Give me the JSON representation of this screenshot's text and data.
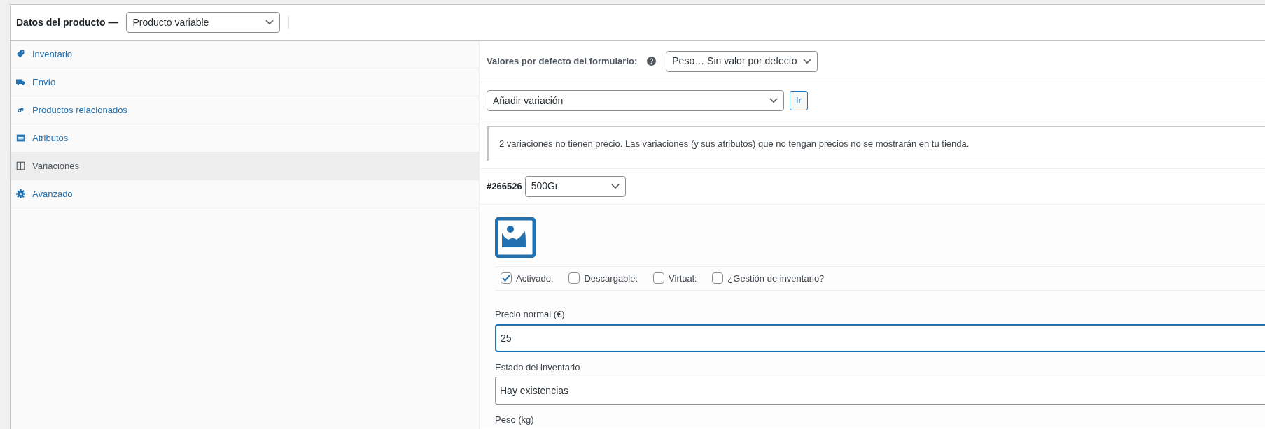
{
  "header": {
    "title": "Datos del producto —",
    "product_type": "Producto variable"
  },
  "sidebar": {
    "items": [
      {
        "label": "Inventario",
        "kind": "tag",
        "selected": false
      },
      {
        "label": "Envío",
        "kind": "truck",
        "selected": false
      },
      {
        "label": "Productos relacionados",
        "kind": "link",
        "selected": false
      },
      {
        "label": "Atributos",
        "kind": "list",
        "selected": false
      },
      {
        "label": "Variaciones",
        "kind": "grid",
        "selected": true
      },
      {
        "label": "Avanzado",
        "kind": "gear",
        "selected": false
      }
    ]
  },
  "variations": {
    "defaults": {
      "label": "Valores por defecto del formulario:",
      "value": "Peso… Sin valor por defecto"
    },
    "add_select": {
      "value": "Añadir variación"
    },
    "go_button": "Ir",
    "notice": "2 variaciones no tienen precio. Las variaciones (y sus atributos) que no tengan precios no se mostrarán en tu tienda.",
    "variation": {
      "id": "#266526",
      "attribute": "500Gr",
      "options": [
        {
          "label": "Activado:",
          "checked": true
        },
        {
          "label": "Descargable:",
          "checked": false
        },
        {
          "label": "Virtual:",
          "checked": false
        },
        {
          "label": "¿Gestión de inventario?",
          "checked": false
        }
      ],
      "fields": [
        {
          "label": "Precio normal (€)",
          "value": "25",
          "focused": true
        },
        {
          "label": "Estado del inventario",
          "value": "Hay existencias",
          "focused": false
        },
        {
          "label": "Peso (kg)"
        }
      ]
    }
  }
}
